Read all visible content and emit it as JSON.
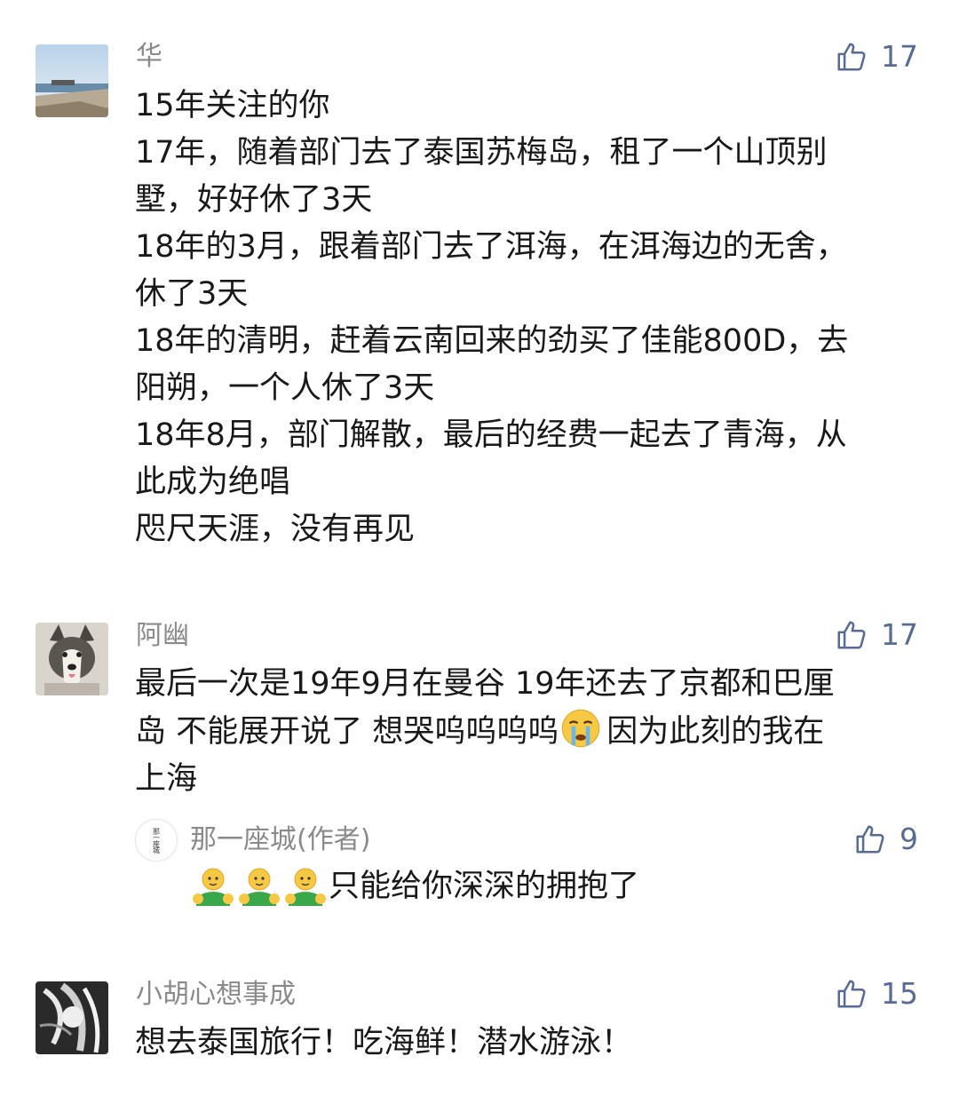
{
  "comments": [
    {
      "username": "华",
      "likes": "17",
      "lines": [
        "15年关注的你",
        "17年，随着部门去了泰国苏梅岛，租了一个山顶别",
        "墅，好好休了3天",
        "18年的3月，跟着部门去了洱海，在洱海边的无舍，",
        "休了3天",
        "18年的清明，赶着云南回来的劲买了佳能800D，去",
        "阳朔，一个人休了3天",
        "18年8月，部门解散，最后的经费一起去了青海，从",
        "此成为绝唱",
        "咫尺天涯，没有再见"
      ]
    },
    {
      "username": "阿幽",
      "likes": "17",
      "line1": "最后一次是19年9月在曼谷 19年还去了京都和巴厘",
      "line2a": "岛 不能展开说了 想哭呜呜呜呜",
      "line2b": "因为此刻的我在",
      "line3": "上海",
      "reply": {
        "username": "那一座城(作者)",
        "likes": "9",
        "text": "只能给你深深的拥抱了",
        "avatar_text": "那一座城"
      }
    },
    {
      "username": "小胡心想事成",
      "likes": "15",
      "lines": [
        "想去泰国旅行！吃海鲜！潜水游泳！"
      ]
    }
  ],
  "colors": {
    "like": "#576b95",
    "name": "#8a8a8a",
    "text": "#191919"
  },
  "icons": {
    "like": "thumbs-up-icon",
    "emoji_cry": "crying-face-emoji",
    "emoji_hug": "hug-emoji"
  }
}
